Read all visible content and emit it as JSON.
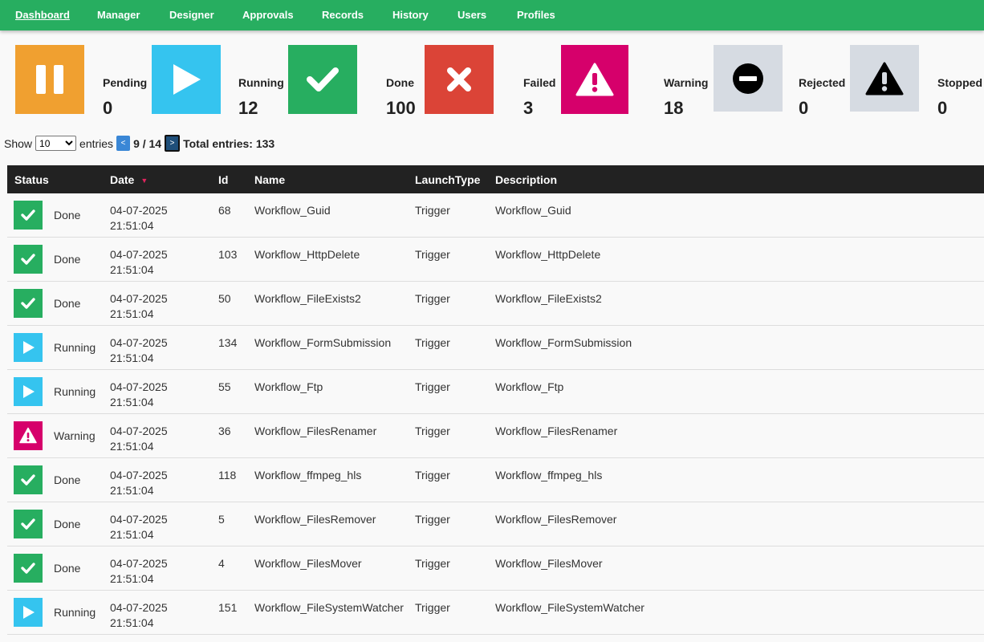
{
  "nav": {
    "items": [
      {
        "label": "Dashboard",
        "active": true
      },
      {
        "label": "Manager"
      },
      {
        "label": "Designer"
      },
      {
        "label": "Approvals"
      },
      {
        "label": "Records"
      },
      {
        "label": "History"
      },
      {
        "label": "Users"
      },
      {
        "label": "Profiles"
      }
    ]
  },
  "cards": [
    {
      "label": "Pending",
      "value": "0",
      "icon": "pause-icon",
      "color": "#f0a030"
    },
    {
      "label": "Running",
      "value": "12",
      "icon": "play-icon",
      "color": "#35c4ef"
    },
    {
      "label": "Done",
      "value": "100",
      "icon": "check-icon",
      "color": "#27ae60"
    },
    {
      "label": "Failed",
      "value": "3",
      "icon": "cross-icon",
      "color": "#db4437"
    },
    {
      "label": "Warning",
      "value": "18",
      "icon": "warning-icon",
      "color": "#d6006b"
    },
    {
      "label": "Rejected",
      "value": "0",
      "icon": "minus-circle-icon",
      "color": "#d6dbe2"
    },
    {
      "label": "Stopped",
      "value": "0",
      "icon": "alert-triangle-icon",
      "color": "#d6dbe2"
    }
  ],
  "entries": {
    "show_label": "Show",
    "selected": "10",
    "entries_label": "entries",
    "prev_label": "<",
    "page_text": "9 / 14",
    "next_label": ">",
    "total_text": "Total entries: 133"
  },
  "table": {
    "headers": {
      "status": "Status",
      "date": "Date",
      "id": "Id",
      "name": "Name",
      "launch": "LaunchType",
      "description": "Description"
    },
    "rows": [
      {
        "status": "Done",
        "date": "04-07-2025",
        "time": "21:51:04",
        "id": "68",
        "name": "Workflow_Guid",
        "launch": "Trigger",
        "description": "Workflow_Guid"
      },
      {
        "status": "Done",
        "date": "04-07-2025",
        "time": "21:51:04",
        "id": "103",
        "name": "Workflow_HttpDelete",
        "launch": "Trigger",
        "description": "Workflow_HttpDelete"
      },
      {
        "status": "Done",
        "date": "04-07-2025",
        "time": "21:51:04",
        "id": "50",
        "name": "Workflow_FileExists2",
        "launch": "Trigger",
        "description": "Workflow_FileExists2"
      },
      {
        "status": "Running",
        "date": "04-07-2025",
        "time": "21:51:04",
        "id": "134",
        "name": "Workflow_FormSubmission",
        "launch": "Trigger",
        "description": "Workflow_FormSubmission"
      },
      {
        "status": "Running",
        "date": "04-07-2025",
        "time": "21:51:04",
        "id": "55",
        "name": "Workflow_Ftp",
        "launch": "Trigger",
        "description": "Workflow_Ftp"
      },
      {
        "status": "Warning",
        "date": "04-07-2025",
        "time": "21:51:04",
        "id": "36",
        "name": "Workflow_FilesRenamer",
        "launch": "Trigger",
        "description": "Workflow_FilesRenamer"
      },
      {
        "status": "Done",
        "date": "04-07-2025",
        "time": "21:51:04",
        "id": "118",
        "name": "Workflow_ffmpeg_hls",
        "launch": "Trigger",
        "description": "Workflow_ffmpeg_hls"
      },
      {
        "status": "Done",
        "date": "04-07-2025",
        "time": "21:51:04",
        "id": "5",
        "name": "Workflow_FilesRemover",
        "launch": "Trigger",
        "description": "Workflow_FilesRemover"
      },
      {
        "status": "Done",
        "date": "04-07-2025",
        "time": "21:51:04",
        "id": "4",
        "name": "Workflow_FilesMover",
        "launch": "Trigger",
        "description": "Workflow_FilesMover"
      },
      {
        "status": "Running",
        "date": "04-07-2025",
        "time": "21:51:04",
        "id": "151",
        "name": "Workflow_FileSystemWatcher",
        "launch": "Trigger",
        "description": "Workflow_FileSystemWatcher"
      }
    ]
  },
  "status_styles": {
    "Done": {
      "color": "#27ae60",
      "icon": "check-icon"
    },
    "Running": {
      "color": "#35c4ef",
      "icon": "play-icon"
    },
    "Warning": {
      "color": "#d6006b",
      "icon": "warning-icon"
    }
  }
}
